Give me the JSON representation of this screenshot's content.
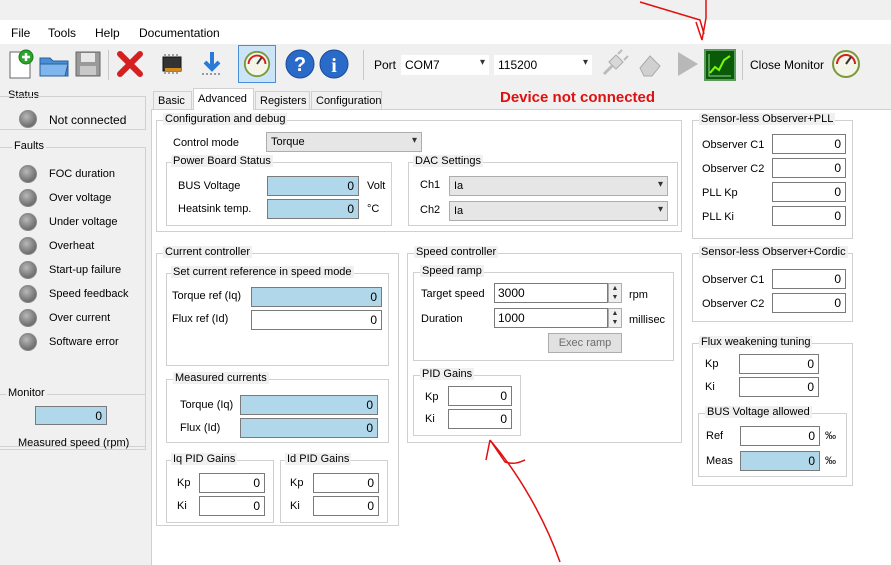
{
  "menu": [
    "File",
    "Tools",
    "Help",
    "Documentation"
  ],
  "toolbar": {
    "port_label": "Port",
    "port_value": "COM7",
    "baud_value": "115200",
    "close_monitor": "Close Monitor"
  },
  "status": {
    "title": "Status",
    "state": "Not connected"
  },
  "faults": {
    "title": "Faults",
    "items": [
      "FOC duration",
      "Over voltage",
      "Under voltage",
      "Overheat",
      "Start-up failure",
      "Speed feedback",
      "Over current",
      "Software error"
    ]
  },
  "monitor": {
    "title": "Monitor",
    "value": "0",
    "label": "Measured speed (rpm)"
  },
  "tabs": [
    "Basic",
    "Advanced",
    "Registers",
    "Configuration"
  ],
  "device_status": "Device not connected",
  "config": {
    "title": "Configuration and debug",
    "control_mode_label": "Control mode",
    "control_mode_value": "Torque",
    "power_board": {
      "title": "Power Board Status",
      "bus_voltage_label": "BUS Voltage",
      "bus_voltage_value": "0",
      "bus_voltage_unit": "Volt",
      "heatsink_label": "Heatsink temp.",
      "heatsink_value": "0",
      "heatsink_unit": "°C"
    },
    "dac": {
      "title": "DAC Settings",
      "ch1_label": "Ch1",
      "ch1_value": "Ia",
      "ch2_label": "Ch2",
      "ch2_value": "Ia"
    }
  },
  "current_controller": {
    "title": "Current controller",
    "ref_title": "Set current reference in speed mode",
    "torque_ref_label": "Torque ref (Iq)",
    "torque_ref_value": "0",
    "flux_ref_label": "Flux ref (Id)",
    "flux_ref_value": "0",
    "measured_title": "Measured currents",
    "torque_label": "Torque (Iq)",
    "torque_value": "0",
    "flux_label": "Flux (Id)",
    "flux_value": "0",
    "iq_pid": {
      "title": "Iq PID Gains",
      "kp_label": "Kp",
      "kp": "0",
      "ki_label": "Ki",
      "ki": "0"
    },
    "id_pid": {
      "title": "Id PID Gains",
      "kp_label": "Kp",
      "kp": "0",
      "ki_label": "Ki",
      "ki": "0"
    }
  },
  "speed_controller": {
    "title": "Speed controller",
    "ramp_title": "Speed ramp",
    "target_label": "Target speed",
    "target_value": "3000",
    "target_unit": "rpm",
    "duration_label": "Duration",
    "duration_value": "1000",
    "duration_unit": "millisec",
    "exec_ramp": "Exec ramp",
    "pid": {
      "title": "PID Gains",
      "kp_label": "Kp",
      "kp": "0",
      "ki_label": "Ki",
      "ki": "0"
    }
  },
  "observer_pll": {
    "title": "Sensor-less Observer+PLL",
    "c1_label": "Observer C1",
    "c1": "0",
    "c2_label": "Observer C2",
    "c2": "0",
    "kp_label": "PLL Kp",
    "kp": "0",
    "ki_label": "PLL Ki",
    "ki": "0"
  },
  "observer_cordic": {
    "title": "Sensor-less Observer+Cordic",
    "c1_label": "Observer C1",
    "c1": "0",
    "c2_label": "Observer C2",
    "c2": "0"
  },
  "flux_weakening": {
    "title": "Flux weakening tuning",
    "kp_label": "Kp",
    "kp": "0",
    "ki_label": "Ki",
    "ki": "0",
    "bus_title": "BUS Voltage allowed",
    "ref_label": "Ref",
    "ref": "0",
    "ref_unit": "‰",
    "meas_label": "Meas",
    "meas": "0",
    "meas_unit": "‰"
  },
  "colors": {
    "accent": "#e01010",
    "readonly_field": "#b0d8ea",
    "annotation": "#e01010"
  }
}
